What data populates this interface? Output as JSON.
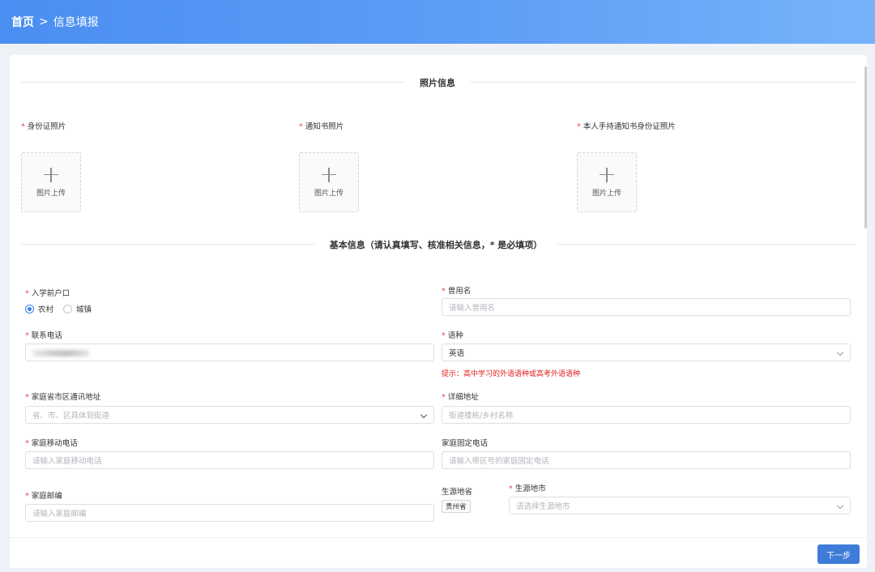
{
  "header": {
    "home": "首页",
    "separator": ">",
    "current": "信息填报"
  },
  "photo_section": {
    "title": "照片信息",
    "uploads": [
      {
        "label": "身份证照片",
        "button_text": "图片上传"
      },
      {
        "label": "通知书照片",
        "button_text": "图片上传"
      },
      {
        "label": "本人手持通知书身份证照片",
        "button_text": "图片上传"
      }
    ]
  },
  "basic_section": {
    "title": "基本信息（请认真填写、核准相关信息，* 是必填项）"
  },
  "required_mark": "*",
  "fields": {
    "hukou": {
      "label": "入学前户口",
      "options": [
        "农村",
        "城镇"
      ],
      "selected": "农村"
    },
    "former_name": {
      "label": "曾用名",
      "placeholder": "请输入曾用名"
    },
    "phone": {
      "label": "联系电话"
    },
    "language": {
      "label": "语种",
      "value": "英语",
      "hint": "提示：高中学习的外语语种或高考外语语种"
    },
    "home_address": {
      "label": "家庭省市区通讯地址",
      "placeholder": "省、市、区具体到街道"
    },
    "detail_address": {
      "label": "详细地址",
      "placeholder": "街道楼栋/乡村名称"
    },
    "home_mobile": {
      "label": "家庭移动电话",
      "placeholder": "请输入家庭移动电话"
    },
    "home_landline": {
      "label": "家庭固定电话",
      "placeholder": "请输入带区号的家庭固定电话"
    },
    "postcode": {
      "label": "家庭邮编",
      "placeholder": "请输入家庭邮编"
    },
    "origin_province": {
      "label": "生源地省",
      "value": "贵州省"
    },
    "origin_city": {
      "label": "生源地市",
      "placeholder": "请选择生源地市"
    }
  },
  "footer": {
    "next_label": "下一步"
  },
  "colors": {
    "accent": "#3f7bd8",
    "header_start": "#4a8ef1",
    "header_end": "#76b3f9",
    "required": "#f04040",
    "hint": "#e02020"
  }
}
